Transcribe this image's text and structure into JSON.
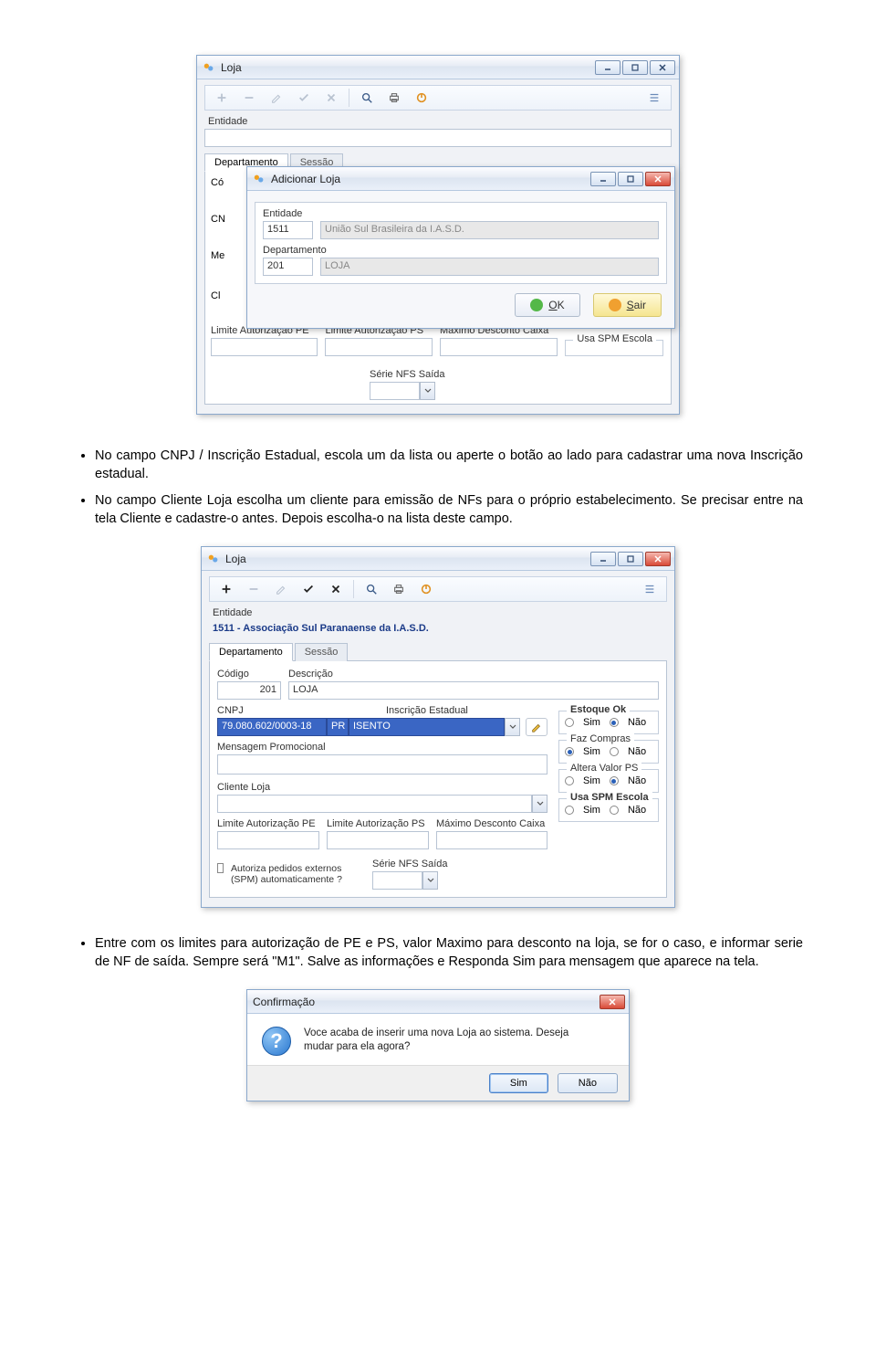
{
  "screenshot1": {
    "bg_window": {
      "title": "Loja",
      "entidade_label": "Entidade",
      "tabs": {
        "departamento": "Departamento",
        "sessao": "Sessão"
      },
      "truncated": {
        "co": "Có",
        "cn": "CN",
        "me": "Me",
        "cl": "Cl"
      },
      "limite_pe": "Limite Autorização PE",
      "limite_ps": "Limite Autorização PS",
      "max_desc": "Máximo Desconto Caixa",
      "serie_nfs": "Série NFS Saída",
      "usa_spm": "Usa SPM Escola"
    },
    "modal": {
      "title": "Adicionar Loja",
      "entidade_label": "Entidade",
      "entidade_code": "1511",
      "entidade_name": "União Sul Brasileira da I.A.S.D.",
      "departamento_label": "Departamento",
      "departamento_code": "201",
      "departamento_name": "LOJA",
      "ok": "OK",
      "sair": "Sair"
    }
  },
  "text": {
    "bullet1": "No campo CNPJ / Inscrição Estadual, escola um da lista ou aperte o botão ao lado para cadastrar uma nova Inscrição estadual.",
    "bullet2": "No campo Cliente Loja escolha um cliente para emissão de NFs para o próprio estabelecimento. Se precisar entre na tela Cliente e cadastre-o antes. Depois escolha-o na lista deste campo.",
    "bullet3": "Entre com os  limites para autorização de PE e PS, valor Maximo para desconto na loja, se for o caso, e informar serie de NF de saída. Sempre será \"M1\".  Salve as informações e Responda Sim para mensagem que aparece na tela."
  },
  "screenshot2": {
    "title": "Loja",
    "entidade_label": "Entidade",
    "entidade_text": "1511 - Associação Sul Paranaense da I.A.S.D.",
    "tabs": {
      "departamento": "Departamento",
      "sessao": "Sessão"
    },
    "codigo_label": "Código",
    "descricao_label": "Descrição",
    "codigo_val": "201",
    "descricao_val": "LOJA",
    "cnpj_label": "CNPJ",
    "inscr_label": "Inscrição Estadual",
    "cnpj_val": "79.080.602/0003-18",
    "uf_val": "PR",
    "inscr_val": "ISENTO",
    "msg_promo": "Mensagem Promocional",
    "cliente_loja": "Cliente Loja",
    "limite_pe": "Limite Autorização PE",
    "limite_ps": "Limite Autorização PS",
    "max_desc": "Máximo Desconto Caixa",
    "autoriza_chk": "Autoriza pedidos externos (SPM) automaticamente ?",
    "serie_nfs": "Série NFS Saída",
    "groups": {
      "estoque": "Estoque Ok",
      "faz_compras": "Faz Compras",
      "altera_ps": "Altera Valor PS",
      "usa_spm": "Usa SPM Escola"
    },
    "radio": {
      "sim": "Sim",
      "nao": "Não"
    }
  },
  "dialog3": {
    "title": "Confirmação",
    "message": "Voce acaba de inserir uma nova Loja ao sistema. Deseja mudar para ela agora?",
    "sim": "Sim",
    "nao": "Não"
  }
}
